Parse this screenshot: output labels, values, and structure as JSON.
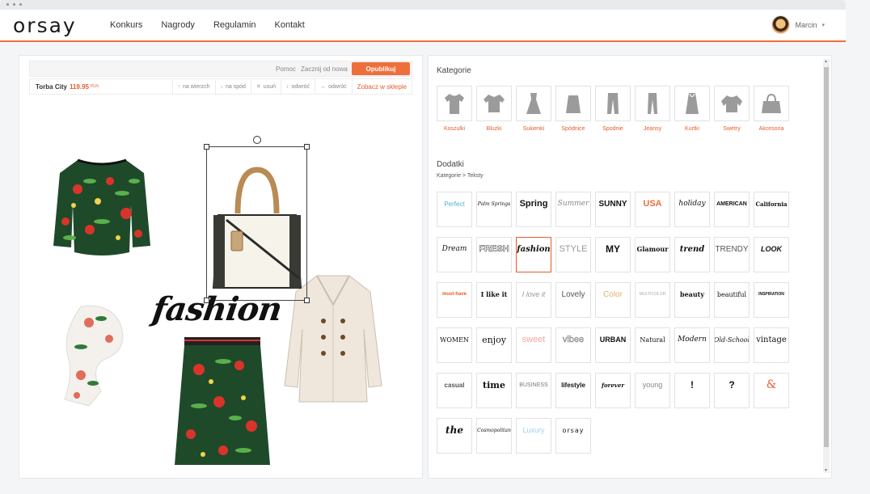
{
  "brand": "orsay",
  "nav": [
    "Konkurs",
    "Nagrody",
    "Regulamin",
    "Kontakt"
  ],
  "user": {
    "name": "Marcin",
    "caret": "▾"
  },
  "editor": {
    "help": "Pomoc",
    "restart": "Zacznij od nowa",
    "publish": "Opublikuj",
    "item_name": "Torba City",
    "item_price": "119.95",
    "item_currency": "PLN",
    "tools": [
      {
        "icon": "↑",
        "label": "na wierzch"
      },
      {
        "icon": "↓",
        "label": "na spód"
      },
      {
        "icon": "✕",
        "label": "usuń"
      },
      {
        "icon": "↕",
        "label": "odwróć"
      },
      {
        "icon": "↔",
        "label": "odwróć"
      }
    ],
    "shop_link": "Zobacz w sklepie",
    "canvas_text": "fashion"
  },
  "categories": {
    "title": "Kategorie",
    "items": [
      "Koszulki",
      "Bluzki",
      "Sukienki",
      "Spódnice",
      "Spodnie",
      "Jeansy",
      "Kurtki",
      "Swetry",
      "Akcesoria"
    ]
  },
  "addons": {
    "title": "Dodatki",
    "breadcrumb": "Kategorie > Teksty",
    "tiles": [
      "Perfect",
      "Palm Springs",
      "Spring",
      "Summer",
      "SUNNY",
      "USA",
      "holiday",
      "AMERICAN",
      "California",
      "Dream",
      "FRESH",
      "fashion",
      "STYLE",
      "MY",
      "Glamour",
      "trend",
      "TRENDY",
      "LOOK",
      "must-have",
      "I like it",
      "I love it",
      "Lovely",
      "Color",
      "MULTICOLOR",
      "beauty",
      "beautiful",
      "INSPIRATION",
      "WOMEN",
      "enjoy",
      "sweet",
      "vibee",
      "URBAN",
      "Natural",
      "Modern",
      "Old-School",
      "vintage",
      "casual",
      "time",
      "BUSINESS",
      "lifestyle",
      "forever",
      "young",
      "!",
      "?",
      "&",
      "the",
      "Cosmopolitan",
      "Luxury",
      "orsay"
    ]
  }
}
